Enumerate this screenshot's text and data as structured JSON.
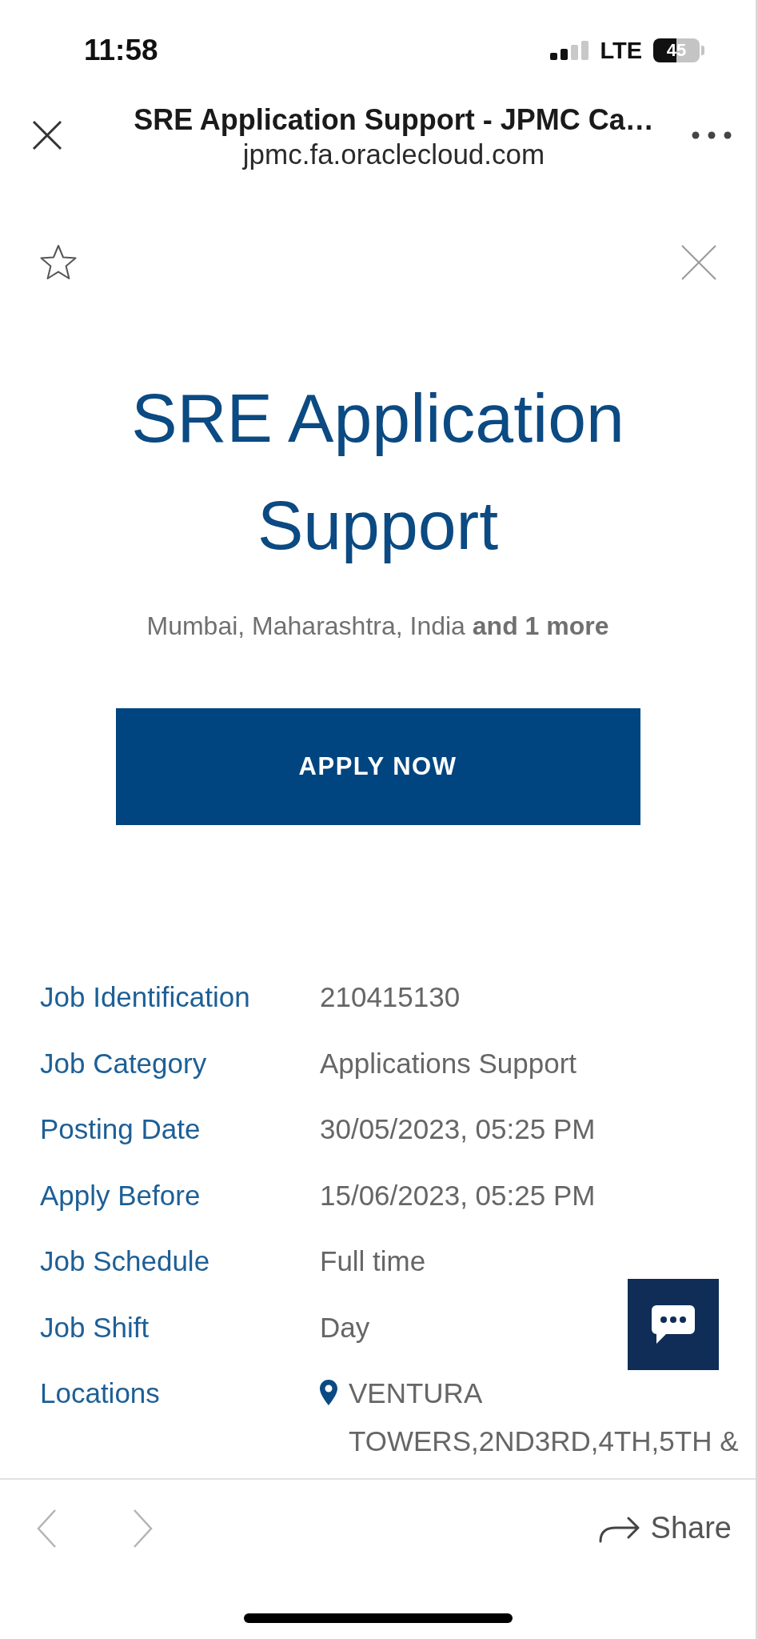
{
  "status_bar": {
    "time": "11:58",
    "network": "LTE",
    "battery": "45"
  },
  "browser_header": {
    "title": "SRE Application Support - JPMC Ca…",
    "url": "jpmc.fa.oraclecloud.com"
  },
  "job": {
    "starred": false,
    "title": "SRE Application Support",
    "location": "Mumbai, Maharashtra, India **and 1 more**",
    "apply_button": "APPLY NOW"
  },
  "details": [
    {
      "kind": "text",
      "label": "Job Identification",
      "value": "210415130"
    },
    {
      "kind": "text",
      "label": "Job Category",
      "value": "Applications Support"
    },
    {
      "kind": "text",
      "label": "Posting Date",
      "value": "30/05/2023, 05:25 PM"
    },
    {
      "kind": "text",
      "label": "Apply Before",
      "value": "15/06/2023, 05:25 PM"
    },
    {
      "kind": "text",
      "label": "Job Schedule",
      "value": "Full time"
    },
    {
      "kind": "text",
      "label": "Job Shift",
      "value": "Day"
    },
    {
      "kind": "location",
      "label": "Locations",
      "value": "VENTURA TOWERS,2ND3RD,4TH,5TH &"
    }
  ],
  "bottom_bar": {
    "nav": [
      {
        "kind": "back",
        "disabled": true
      },
      {
        "kind": "forward",
        "disabled": true
      }
    ],
    "share": "Share"
  }
}
